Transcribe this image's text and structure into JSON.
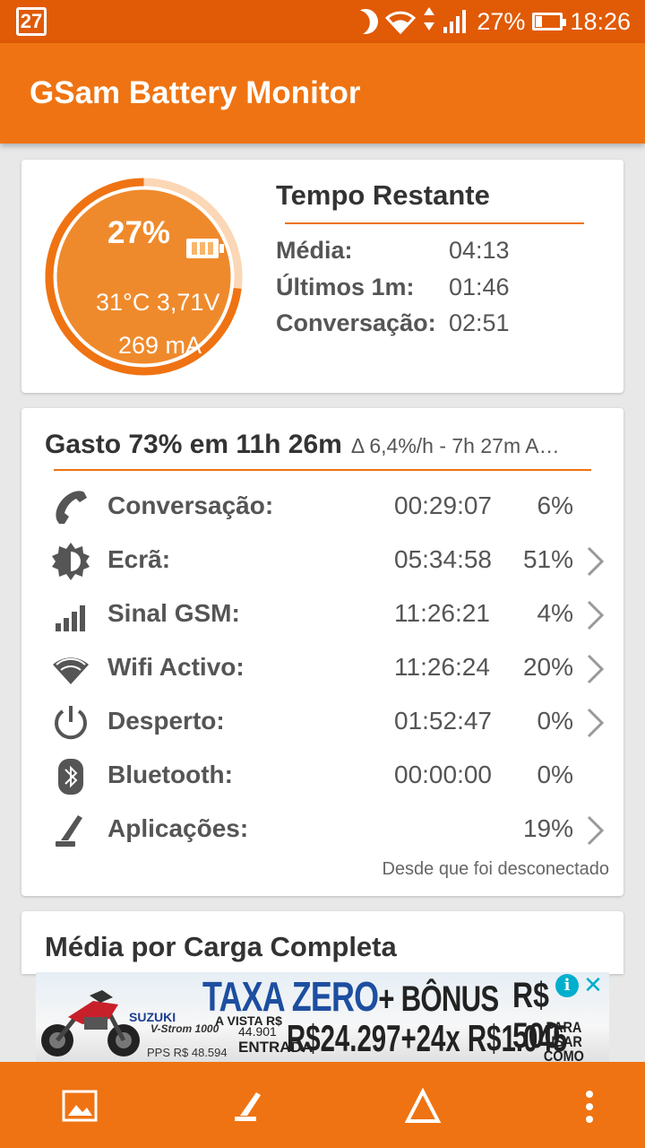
{
  "status_bar": {
    "calendar_day": "27",
    "battery_text": "27%",
    "time": "18:26",
    "icons": [
      "calendar-icon",
      "moon-icon",
      "wifi-icon",
      "data-arrows-icon",
      "cell-signal-icon",
      "battery-icon"
    ]
  },
  "app_bar": {
    "title": "GSam Battery Monitor"
  },
  "gauge": {
    "percent_text": "27%",
    "temp_voltage": "31°C  3,71V",
    "current": "269 mA",
    "level": 0.27,
    "ring_color": "#ef8a2c"
  },
  "tempo": {
    "title": "Tempo Restante",
    "rows": [
      {
        "label": "Média:",
        "value": "04:13"
      },
      {
        "label": "Últimos 1m:",
        "value": "01:46"
      },
      {
        "label": "Conversação:",
        "value": "02:51"
      }
    ]
  },
  "usage": {
    "title": "Gasto 73% em 11h 26m",
    "rate": "Δ 6,4%/h - 7h 27m A…",
    "rows": [
      {
        "icon": "phone-icon",
        "label": "Conversação:",
        "time": "00:29:07",
        "pct": "6%",
        "chevron": false
      },
      {
        "icon": "screen-brightness-icon",
        "label": "Ecrã:",
        "time": "05:34:58",
        "pct": "51%",
        "chevron": true
      },
      {
        "icon": "signal-bars-icon",
        "label": "Sinal GSM:",
        "time": "11:26:21",
        "pct": "4%",
        "chevron": true
      },
      {
        "icon": "wifi-icon",
        "label": "Wifi Activo:",
        "time": "11:26:24",
        "pct": "20%",
        "chevron": true
      },
      {
        "icon": "power-icon",
        "label": "Desperto:",
        "time": "01:52:47",
        "pct": "0%",
        "chevron": true
      },
      {
        "icon": "bluetooth-icon",
        "label": "Bluetooth:",
        "time": "00:00:00",
        "pct": "0%",
        "chevron": false
      },
      {
        "icon": "apps-icon",
        "label": "Aplicações:",
        "time": "",
        "pct": "19%",
        "chevron": true
      }
    ],
    "footer": "Desde que foi desconectado"
  },
  "media_card": {
    "title": "Média por Carga Completa"
  },
  "ad": {
    "brand": "SUZUKI",
    "model": "V-Strom 1000",
    "headline": "TAXA ZERO",
    "bonus": "+ BÔNUS",
    "bonus_value": "R$ 500",
    "a_vista_label": "A VISTA R$",
    "a_vista_value": "44.901",
    "entrada_label": "ENTRADA",
    "price": "R$24.297+24x R$1.045",
    "para_usar": "PARA USAR COMO QUISER",
    "pps": "PPS R$ 48.594",
    "info": "i",
    "close": "✕"
  },
  "bottom_bar": {
    "buttons": [
      "image-icon",
      "apps-icon",
      "delta-icon",
      "more-icon"
    ]
  },
  "colors": {
    "status_bar": "#e15a06",
    "primary": "#ef7312",
    "accent_rule": "#ef7312"
  }
}
